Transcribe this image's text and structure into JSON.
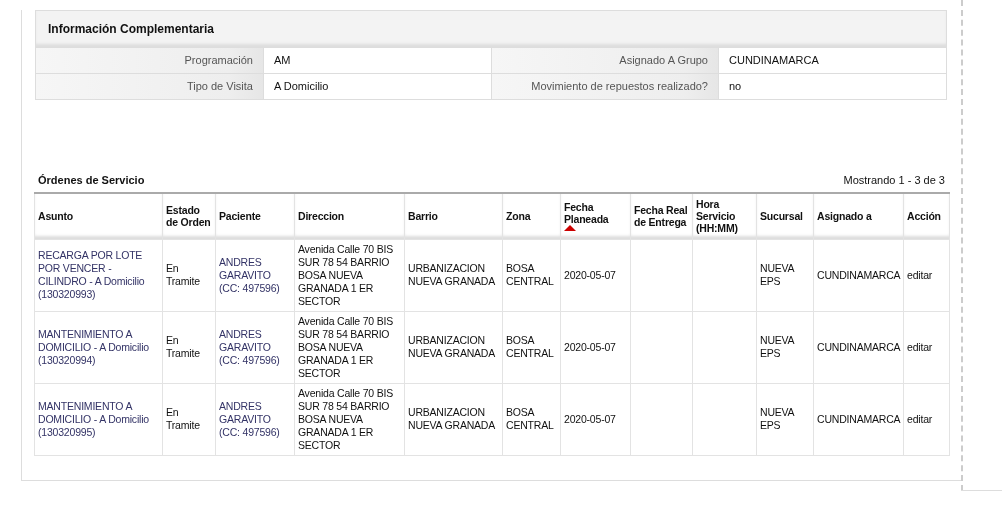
{
  "info_panel": {
    "title": "Información Complementaria",
    "rows": [
      [
        {
          "label": "Programación",
          "value": "AM"
        },
        {
          "label": "Asignado A Grupo",
          "value": "CUNDINAMARCA"
        }
      ],
      [
        {
          "label": "Tipo de Visita",
          "value": "A Domicilio"
        },
        {
          "label": "Movimiento de repuestos realizado?",
          "value": "no"
        }
      ]
    ]
  },
  "orders": {
    "title": "Órdenes de Servicio",
    "pagination": "Mostrando 1 - 3 de 3",
    "columns": [
      {
        "label": "Asunto",
        "sorted": false
      },
      {
        "label": "Estado de Orden",
        "sorted": false
      },
      {
        "label": "Paciente",
        "sorted": false
      },
      {
        "label": "Direccion",
        "sorted": false
      },
      {
        "label": "Barrio",
        "sorted": false
      },
      {
        "label": "Zona",
        "sorted": false
      },
      {
        "label": "Fecha Planeada",
        "sorted": true
      },
      {
        "label": "Fecha Real de Entrega",
        "sorted": false
      },
      {
        "label": "Hora Servicio (HH:MM)",
        "sorted": false
      },
      {
        "label": "Sucursal",
        "sorted": false
      },
      {
        "label": "Asignado a",
        "sorted": false
      },
      {
        "label": "Acción",
        "sorted": false
      }
    ],
    "rows": [
      {
        "asunto": "RECARGA POR LOTE POR VENCER - CILINDRO - A Domicilio (130320993)",
        "estado": "En Tramite",
        "paciente": "ANDRES GARAVITO (CC: 497596)",
        "direccion": "Avenida Calle 70 BIS SUR 78 54 BARRIO BOSA NUEVA GRANADA 1 ER SECTOR",
        "barrio": "URBANIZACION NUEVA GRANADA",
        "zona": "BOSA CENTRAL",
        "fecha_planeada": "2020-05-07",
        "sucursal": "NUEVA EPS",
        "asignado": "CUNDINAMARCA",
        "accion": "editar"
      },
      {
        "asunto": "MANTENIMIENTO A DOMICILIO - A Domicilio (130320994)",
        "estado": "En Tramite",
        "paciente": "ANDRES GARAVITO (CC: 497596)",
        "direccion": "Avenida Calle 70 BIS SUR 78 54 BARRIO BOSA NUEVA GRANADA 1 ER SECTOR",
        "barrio": "URBANIZACION NUEVA GRANADA",
        "zona": "BOSA CENTRAL",
        "fecha_planeada": "2020-05-07",
        "sucursal": "NUEVA EPS",
        "asignado": "CUNDINAMARCA",
        "accion": "editar"
      },
      {
        "asunto": "MANTENIMIENTO A DOMICILIO - A Domicilio (130320995)",
        "estado": "En Tramite",
        "paciente": "ANDRES GARAVITO (CC: 497596)",
        "direccion": "Avenida Calle 70 BIS SUR 78 54 BARRIO BOSA NUEVA GRANADA 1 ER SECTOR",
        "barrio": "URBANIZACION NUEVA GRANADA",
        "zona": "BOSA CENTRAL",
        "fecha_planeada": "2020-05-07",
        "sucursal": "NUEVA EPS",
        "asignado": "CUNDINAMARCA",
        "accion": "editar"
      }
    ]
  }
}
